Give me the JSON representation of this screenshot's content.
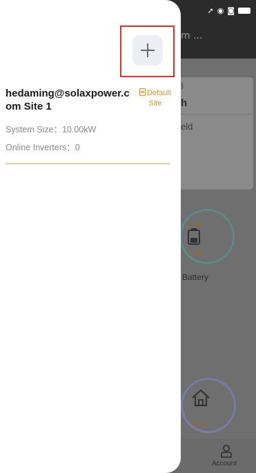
{
  "background": {
    "title": "m ...",
    "card": {
      "line1": "I",
      "line2": "h",
      "line3": "eld"
    },
    "battery": {
      "percent": "0.0%",
      "power": "0.0W",
      "label": "Battery"
    },
    "home": {
      "power": "0.0W"
    },
    "tabbar": {
      "account_label": "Account"
    }
  },
  "drawer": {
    "add_button_label": "+",
    "sites": [
      {
        "name": "hedaming@solaxpower.com Site 1",
        "default_label": "Default Site",
        "system_size": "System Size：10.00kW",
        "online_inverters": "Online Inverters：0"
      }
    ]
  },
  "colors": {
    "accent": "#d4952e",
    "highlight_box": "#e0302a",
    "divider": "#d8a64e"
  },
  "icons": {
    "add": "plus-icon",
    "default_site": "document-icon",
    "home": "home-icon",
    "account": "user-icon",
    "battery": "battery-icon"
  }
}
